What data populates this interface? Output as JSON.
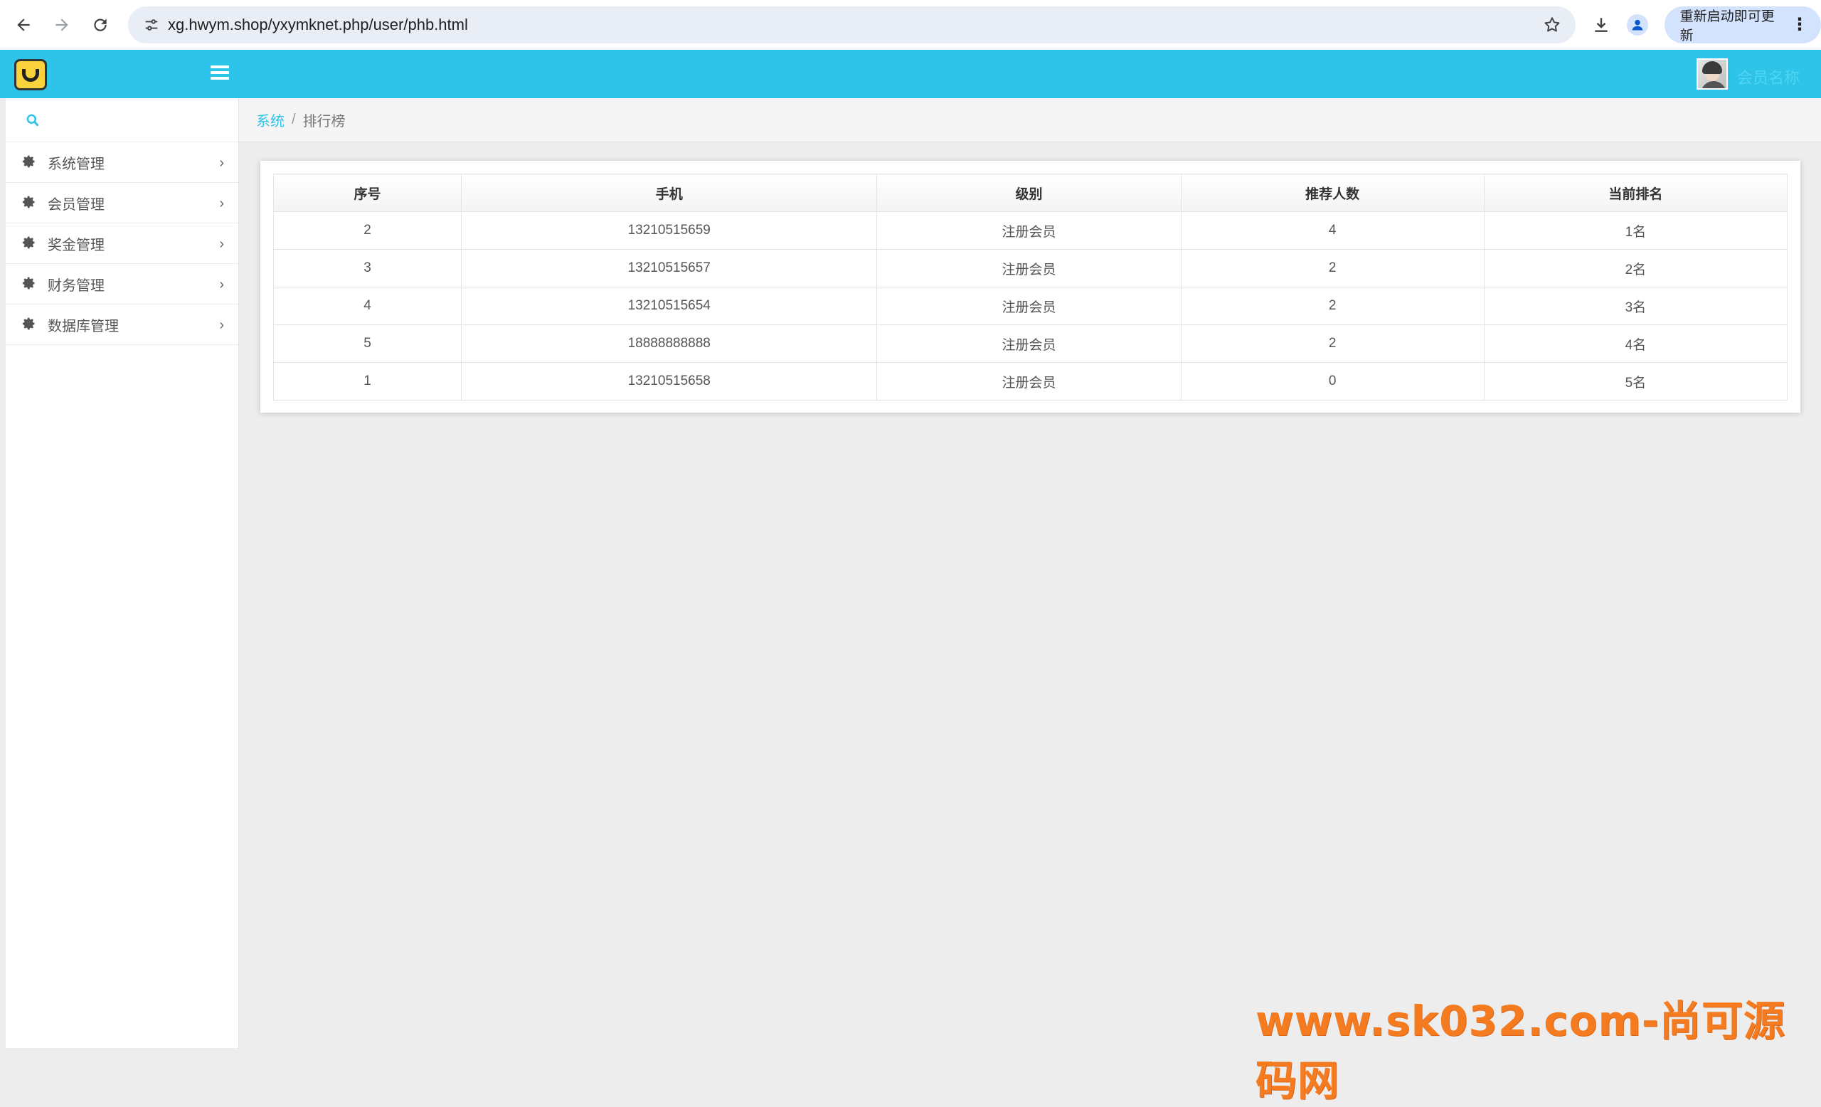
{
  "browser": {
    "url": "xg.hwym.shop/yxymknet.php/user/phb.html",
    "update_label": "重新启动即可更新"
  },
  "header": {
    "user_name": "会员名称"
  },
  "sidebar": {
    "items": [
      {
        "label": "系统管理"
      },
      {
        "label": "会员管理"
      },
      {
        "label": "奖金管理"
      },
      {
        "label": "财务管理"
      },
      {
        "label": "数据库管理"
      }
    ]
  },
  "breadcrumb": {
    "root": "系统",
    "separator": "/",
    "current": "排行榜"
  },
  "table": {
    "headers": [
      "序号",
      "手机",
      "级别",
      "推荐人数",
      "当前排名"
    ],
    "rows": [
      [
        "2",
        "13210515659",
        "注册会员",
        "4",
        "1名"
      ],
      [
        "3",
        "13210515657",
        "注册会员",
        "2",
        "2名"
      ],
      [
        "4",
        "13210515654",
        "注册会员",
        "2",
        "3名"
      ],
      [
        "5",
        "18888888888",
        "注册会员",
        "2",
        "4名"
      ],
      [
        "1",
        "13210515658",
        "注册会员",
        "0",
        "5名"
      ]
    ]
  },
  "watermark": "www.sk032.com-尚可源码网",
  "colors": {
    "accent": "#2ec3e8",
    "watermark": "#f47b20"
  }
}
